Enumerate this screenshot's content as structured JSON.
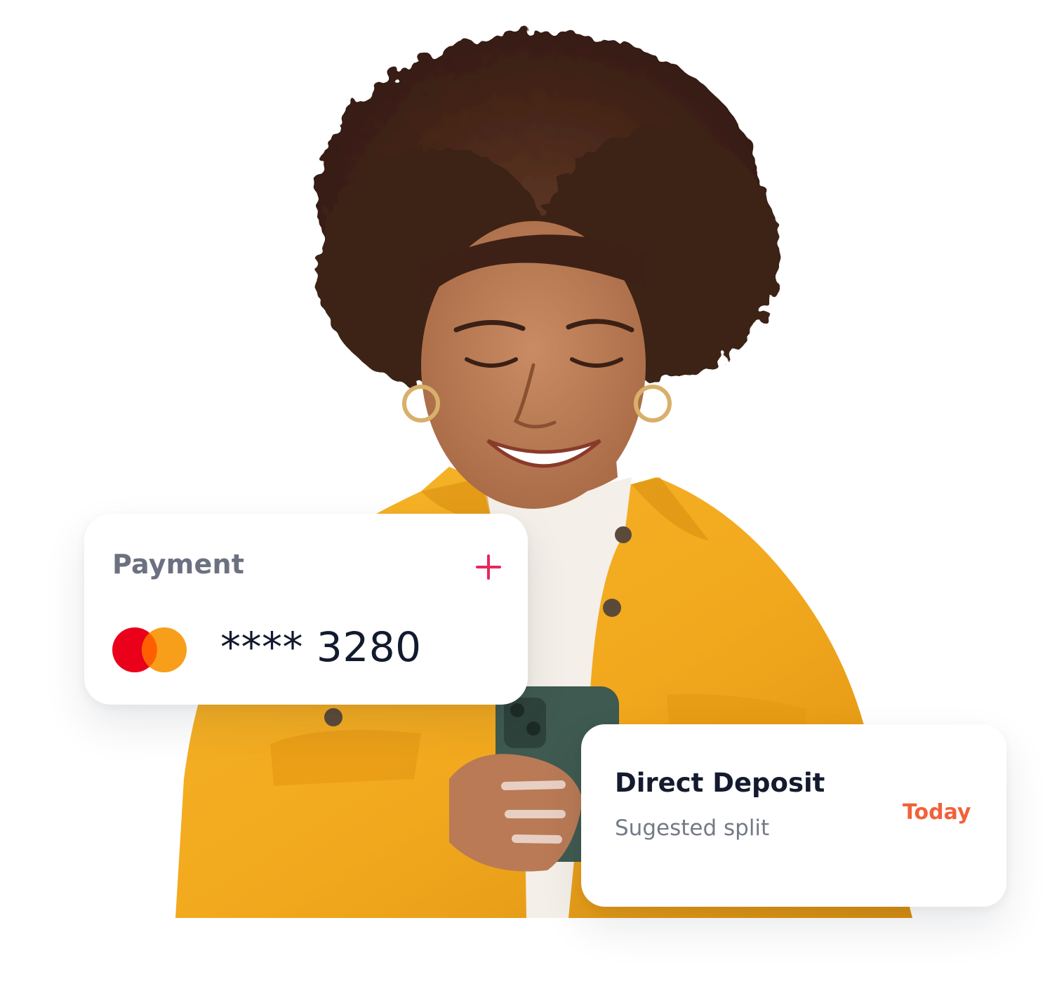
{
  "payment_card": {
    "title": "Payment",
    "add_icon": "plus-icon",
    "card_brand_icon": "mastercard-logo-icon",
    "masked_number": "**** 3280",
    "colors": {
      "title": "#6b7180",
      "add": "#e8275f",
      "brand_left": "#eb001b",
      "brand_right": "#f79e1b",
      "brand_overlap": "#ff5f00"
    }
  },
  "deposit_card": {
    "title": "Direct Deposit",
    "subtitle": "Sugested split",
    "date": "Today",
    "colors": {
      "title": "#141b2f",
      "subtitle": "#747a86",
      "date": "#f2613a"
    }
  },
  "photo": {
    "subject": "person-photo",
    "colors": {
      "jacket": "#f2a81d",
      "turtleneck": "#f4efe8",
      "skin": "#b97a55",
      "hair": "#3d2116",
      "phone": "#3f5a50"
    }
  }
}
